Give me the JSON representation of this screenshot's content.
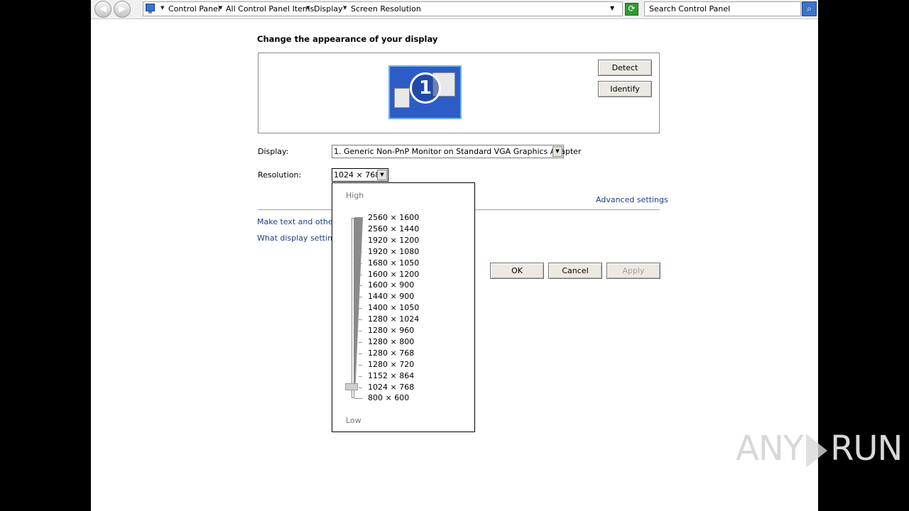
{
  "addressbar": {
    "crumbs": [
      "Control Panel",
      "All Control Panel Items",
      "Display",
      "Screen Resolution"
    ],
    "search_placeholder": "Search Control Panel"
  },
  "main": {
    "heading": "Change the appearance of your display",
    "monitor_number": "1",
    "detect_label": "Detect",
    "identify_label": "Identify",
    "display_label": "Display:",
    "display_value": "1. Generic Non-PnP Monitor on Standard VGA Graphics Adapter",
    "resolution_label": "Resolution:",
    "resolution_value": "1024 × 768",
    "advanced_link": "Advanced settings",
    "link1": "Make text and other it",
    "link2": "What display settings",
    "ok_label": "OK",
    "cancel_label": "Cancel",
    "apply_label": "Apply"
  },
  "popup": {
    "high_label": "High",
    "low_label": "Low",
    "options": [
      "2560 × 1600",
      "2560 × 1440",
      "1920 × 1200",
      "1920 × 1080",
      "1680 × 1050",
      "1600 × 1200",
      "1600 × 900",
      "1440 × 900",
      "1400 × 1050",
      "1280 × 1024",
      "1280 × 960",
      "1280 × 800",
      "1280 × 768",
      "1280 × 720",
      "1152 × 864",
      "1024 × 768",
      "800 × 600"
    ],
    "selected": "1024 × 768"
  },
  "watermark": {
    "left": "ANY",
    "right": "RUN"
  },
  "colors": {
    "link": "#1a3e8a",
    "monitor_blue": "#2d5cc6"
  }
}
